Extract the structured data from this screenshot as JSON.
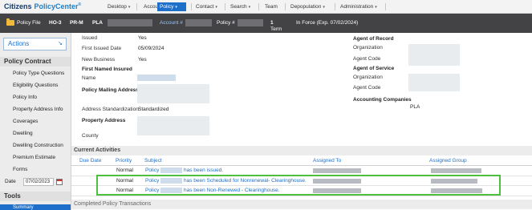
{
  "brand": {
    "name": "Citizens",
    "product": "PolicyCenter",
    "mark": "®"
  },
  "nav": {
    "items": [
      {
        "label": "Desktop"
      },
      {
        "label": "Account"
      },
      {
        "label": "Policy"
      },
      {
        "label": "Contact"
      },
      {
        "label": "Search"
      },
      {
        "label": "Team"
      },
      {
        "label": "Depopulation"
      },
      {
        "label": "Administration"
      }
    ],
    "active": "Policy"
  },
  "infobar": {
    "policy_file": "Policy File",
    "form": "HO-3",
    "program": "PR-M",
    "company": "PLA",
    "account_label": "Account #",
    "policy_label": "Policy #",
    "term_label": "Term",
    "term_value": "1",
    "status": "In Force (Exp. 07/02/2024)"
  },
  "sidebar": {
    "actions_label": "Actions",
    "policy_contract_header": "Policy Contract",
    "items": [
      {
        "label": "Policy Type Questions"
      },
      {
        "label": "Eligibility Questions"
      },
      {
        "label": "Policy Info"
      },
      {
        "label": "Property Address Info"
      },
      {
        "label": "Coverages"
      },
      {
        "label": "Dwelling"
      },
      {
        "label": "Dwelling Construction"
      },
      {
        "label": "Premium Estimate"
      },
      {
        "label": "Forms"
      }
    ],
    "date_label": "Date",
    "date_value": "07/02/2023",
    "tools_header": "Tools",
    "summary_label": "Summary"
  },
  "details": {
    "issued_label": "Issued",
    "issued_value": "Yes",
    "first_issued_label": "First Issued Date",
    "first_issued_value": "05/09/2024",
    "new_business_label": "New Business",
    "new_business_value": "Yes",
    "first_named_insured_label": "First Named Insured",
    "name_label": "Name",
    "mailing_address_label": "Policy Mailing Address",
    "address_std_label": "Address Standardization",
    "address_std_value": "Standardized",
    "property_address_label": "Property Address",
    "county_label": "County"
  },
  "agents": {
    "agent_of_record_label": "Agent of Record",
    "organization_label": "Organization",
    "agent_code_label": "Agent Code",
    "agent_of_service_label": "Agent of Service",
    "organization2_label": "Organization",
    "agent_code2_label": "Agent Code",
    "accounting_companies_label": "Accounting Companies",
    "accounting_company_value": "PLA"
  },
  "activities": {
    "title": "Current Activities",
    "columns": [
      "Due Date",
      "Priority",
      "Subject",
      "Assigned To",
      "Assigned Group"
    ],
    "rows": [
      {
        "due_date": "",
        "priority": "Normal",
        "subject_prefix": "Policy",
        "subject_suffix": "has been issued."
      },
      {
        "due_date": "",
        "priority": "Normal",
        "subject_prefix": "Policy",
        "subject_suffix": "has been Scheduled for Nonrenewal- Clearinghouse."
      },
      {
        "due_date": "",
        "priority": "Normal",
        "subject_prefix": "Policy",
        "subject_suffix": "has been Non-Renewed - Clearinghouse."
      }
    ]
  },
  "completed": {
    "title": "Completed Policy Transactions"
  },
  "colors": {
    "accent": "#1e6fc9",
    "header_dark": "#434346",
    "highlight": "#4fbf3f"
  },
  "icons": [
    "folder-icon",
    "arrow-icon",
    "calendar-icon",
    "chevron-down-icon"
  ]
}
